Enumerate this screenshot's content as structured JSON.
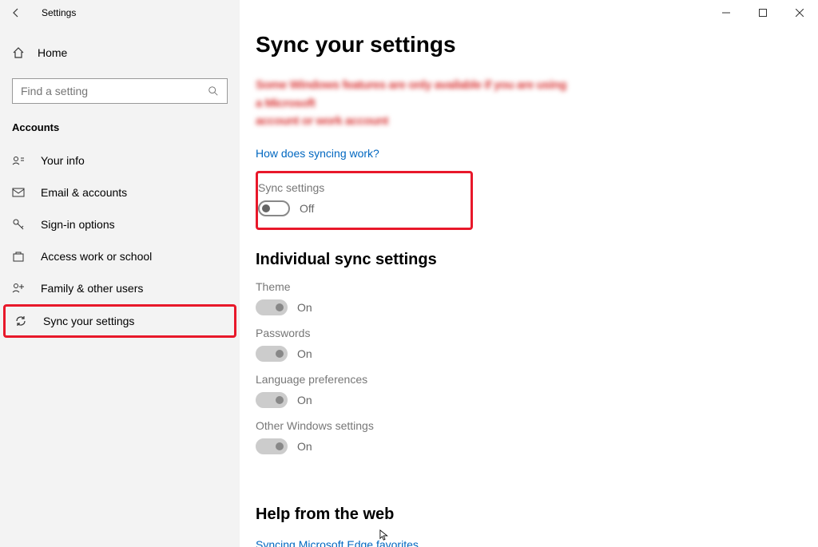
{
  "app": {
    "title": "Settings"
  },
  "sidebar": {
    "home": "Home",
    "searchPlaceholder": "Find a setting",
    "category": "Accounts",
    "items": [
      {
        "label": "Your info"
      },
      {
        "label": "Email & accounts"
      },
      {
        "label": "Sign-in options"
      },
      {
        "label": "Access work or school"
      },
      {
        "label": "Family & other users"
      },
      {
        "label": "Sync your settings"
      }
    ]
  },
  "main": {
    "title": "Sync your settings",
    "blurred1": "Some Windows features are only available if you are using a Microsoft",
    "blurred2": "account or work account",
    "helpLink": "How does syncing work?",
    "syncSettings": {
      "label": "Sync settings",
      "state": "Off"
    },
    "individualHeader": "Individual sync settings",
    "individual": [
      {
        "label": "Theme",
        "state": "On"
      },
      {
        "label": "Passwords",
        "state": "On"
      },
      {
        "label": "Language preferences",
        "state": "On"
      },
      {
        "label": "Other Windows settings",
        "state": "On"
      }
    ],
    "helpHeader": "Help from the web",
    "helpLinks": [
      "Syncing Microsoft Edge favorites"
    ]
  }
}
